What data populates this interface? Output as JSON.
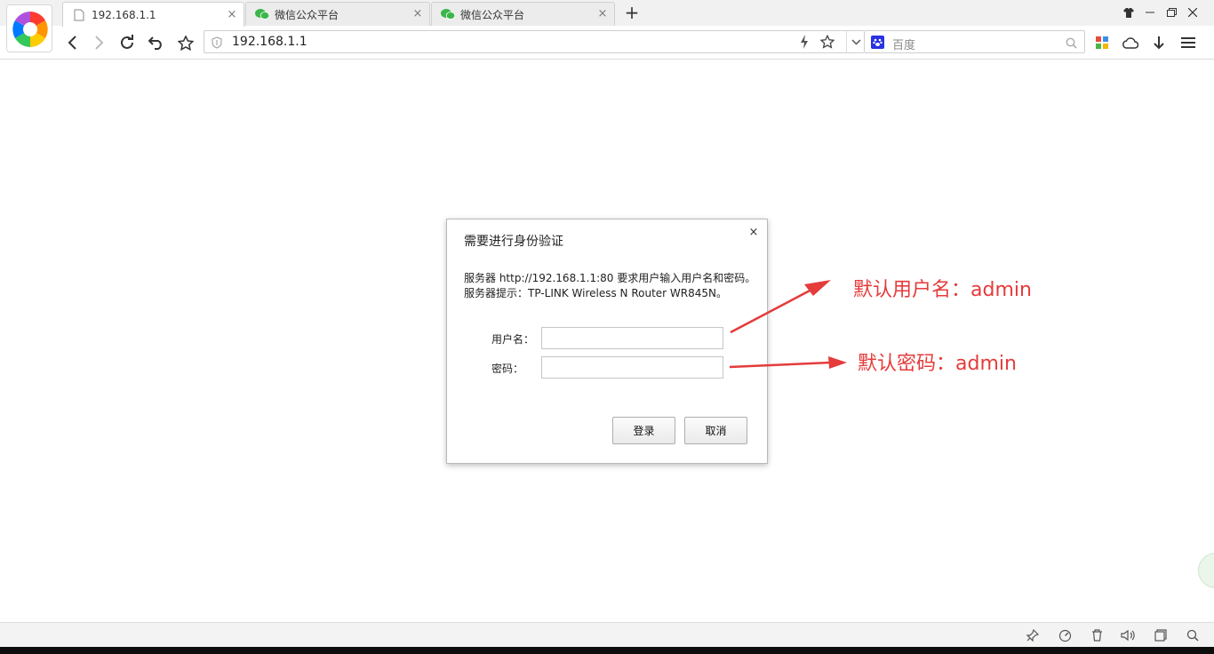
{
  "browser": {
    "tabs": [
      {
        "title": "192.168.1.1",
        "icon": "page-icon",
        "active": true
      },
      {
        "title": "微信公众平台",
        "icon": "wechat-icon",
        "active": false
      },
      {
        "title": "微信公众平台",
        "icon": "wechat-icon",
        "active": false
      }
    ],
    "new_tab_label": "+",
    "address": "192.168.1.1",
    "search_placeholder": "百度"
  },
  "dialog": {
    "title": "需要进行身份验证",
    "close_label": "×",
    "message_line1": "服务器 http://192.168.1.1:80 要求用户输入用户名和密码。",
    "message_line2": "服务器提示：TP-LINK Wireless N Router WR845N。",
    "username_label": "用户名：",
    "password_label": "密码：",
    "username_value": "",
    "password_value": "",
    "login_button": "登录",
    "cancel_button": "取消"
  },
  "annotations": {
    "username_hint": "默认用户名：admin",
    "password_hint": "默认密码：admin",
    "color": "#e53b3b"
  },
  "colors": {
    "wechat_green": "#3bb64a",
    "baidu_blue": "#2932e1"
  }
}
